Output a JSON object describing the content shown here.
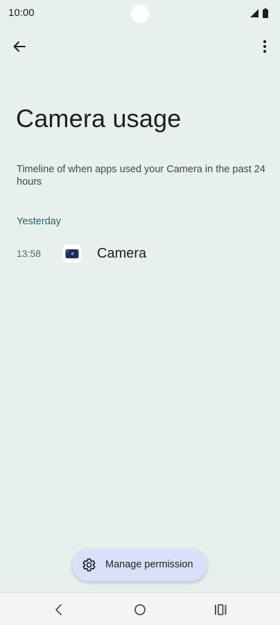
{
  "status_bar": {
    "time": "10:00",
    "icons": [
      "signal-icon",
      "battery-icon"
    ]
  },
  "app_bar": {
    "back_icon": "arrow-left-icon",
    "more_icon": "more-vert-icon"
  },
  "page": {
    "title": "Camera usage",
    "description": "Timeline of when apps used your Camera in the past 24 hours"
  },
  "timeline": {
    "section_label": "Yesterday",
    "entries": [
      {
        "time": "13:58",
        "app_name": "Camera",
        "icon": "camera-app-icon"
      }
    ]
  },
  "actions": {
    "manage_label": "Manage permission",
    "manage_icon": "gear-icon"
  },
  "nav_bar": {
    "icons": [
      "back-nav-icon",
      "home-nav-icon",
      "recents-nav-icon"
    ]
  },
  "colors": {
    "background": "#e8f0ee",
    "accent": "#18686b",
    "button_bg": "#d9e1f9"
  }
}
